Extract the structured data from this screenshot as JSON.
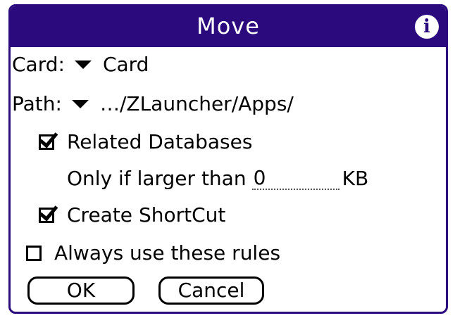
{
  "dialog": {
    "title": "Move",
    "info_icon": "info-icon",
    "info_glyph": "i"
  },
  "card": {
    "label": "Card:",
    "value": "Card"
  },
  "path": {
    "label": "Path:",
    "value": "…/ZLauncher/Apps/"
  },
  "related_databases": {
    "label": "Related Databases",
    "checked": true
  },
  "size_filter": {
    "label": "Only if larger than",
    "value": "0",
    "unit": "KB"
  },
  "create_shortcut": {
    "label": "Create ShortCut",
    "checked": true
  },
  "always_use_rules": {
    "label": "Always use these rules",
    "checked": false
  },
  "buttons": {
    "ok": "OK",
    "cancel": "Cancel"
  },
  "colors": {
    "accent": "#2a0a7d"
  }
}
